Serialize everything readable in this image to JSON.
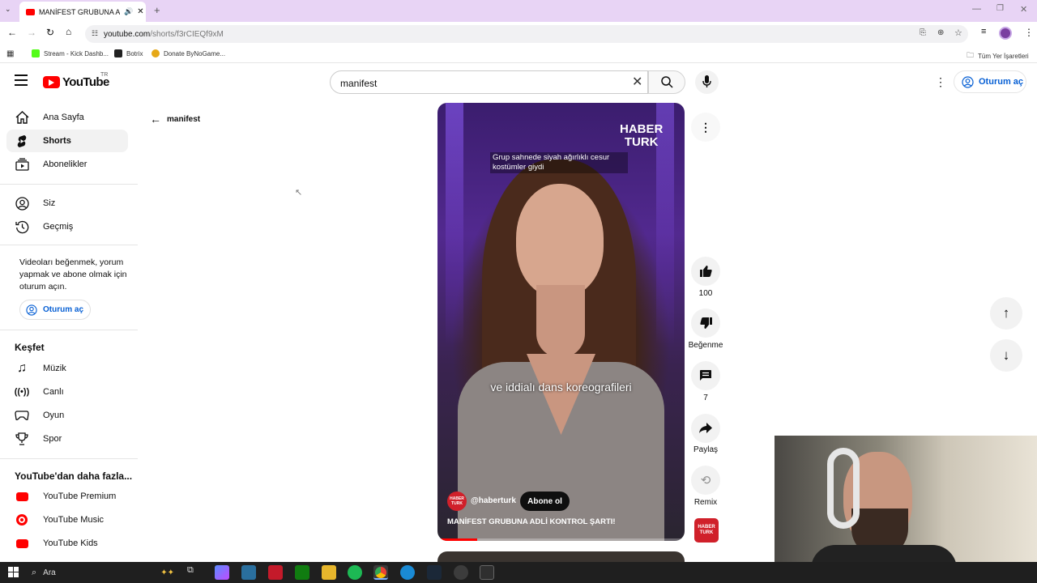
{
  "browser": {
    "tab_title": "MANİFEST GRUBUNA ADLİ",
    "url_host": "youtube.com",
    "url_path": "/shorts/f3rCIEQf9xM",
    "bookmarks": [
      "Stream - Kick Dashb...",
      "Botrix",
      "Donate ByNoGame..."
    ],
    "all_bookmarks": "Tüm Yer İşaretleri"
  },
  "header": {
    "logo_text": "YouTube",
    "region": "TR",
    "search_value": "manifest",
    "signin_label": "Oturum aç"
  },
  "sidebar": {
    "main": [
      {
        "label": "Ana Sayfa",
        "icon": "home-icon"
      },
      {
        "label": "Shorts",
        "icon": "shorts-icon"
      },
      {
        "label": "Abonelikler",
        "icon": "subscriptions-icon"
      }
    ],
    "you": [
      {
        "label": "Siz",
        "icon": "account-icon"
      },
      {
        "label": "Geçmiş",
        "icon": "history-icon"
      }
    ],
    "signin_prompt": "Videoları beğenmek, yorum yapmak ve abone olmak için oturum açın.",
    "signin_button": "Oturum aç",
    "explore_title": "Keşfet",
    "explore": [
      {
        "label": "Müzik",
        "icon": "music-icon"
      },
      {
        "label": "Canlı",
        "icon": "live-icon"
      },
      {
        "label": "Oyun",
        "icon": "gaming-icon"
      },
      {
        "label": "Spor",
        "icon": "trophy-icon"
      }
    ],
    "more_title": "YouTube'dan daha fazla...",
    "more": [
      {
        "label": "YouTube Premium"
      },
      {
        "label": "YouTube Music"
      },
      {
        "label": "YouTube Kids"
      }
    ]
  },
  "back_label": "manifest",
  "short": {
    "overlay_top": "Grup sahnede siyah ağırlıklı cesur kostümler giydi",
    "subtitle": "ve iddialı dans koreografileri",
    "brand_line1": "HABER",
    "brand_line2": "TURK",
    "channel": "@haberturk",
    "subscribe_label": "Abone ol",
    "title": "MANİFEST GRUBUNA ADLİ KONTROL ŞARTI!",
    "like_count": "100",
    "dislike_label": "Beğenme",
    "comment_count": "7",
    "share_label": "Paylaş",
    "remix_label": "Remix"
  },
  "taskbar": {
    "search_placeholder": "Ara"
  },
  "colors": {
    "accent": "#065fd4",
    "brand_red": "#ff0000",
    "tabbar": "#e8d4f5"
  }
}
